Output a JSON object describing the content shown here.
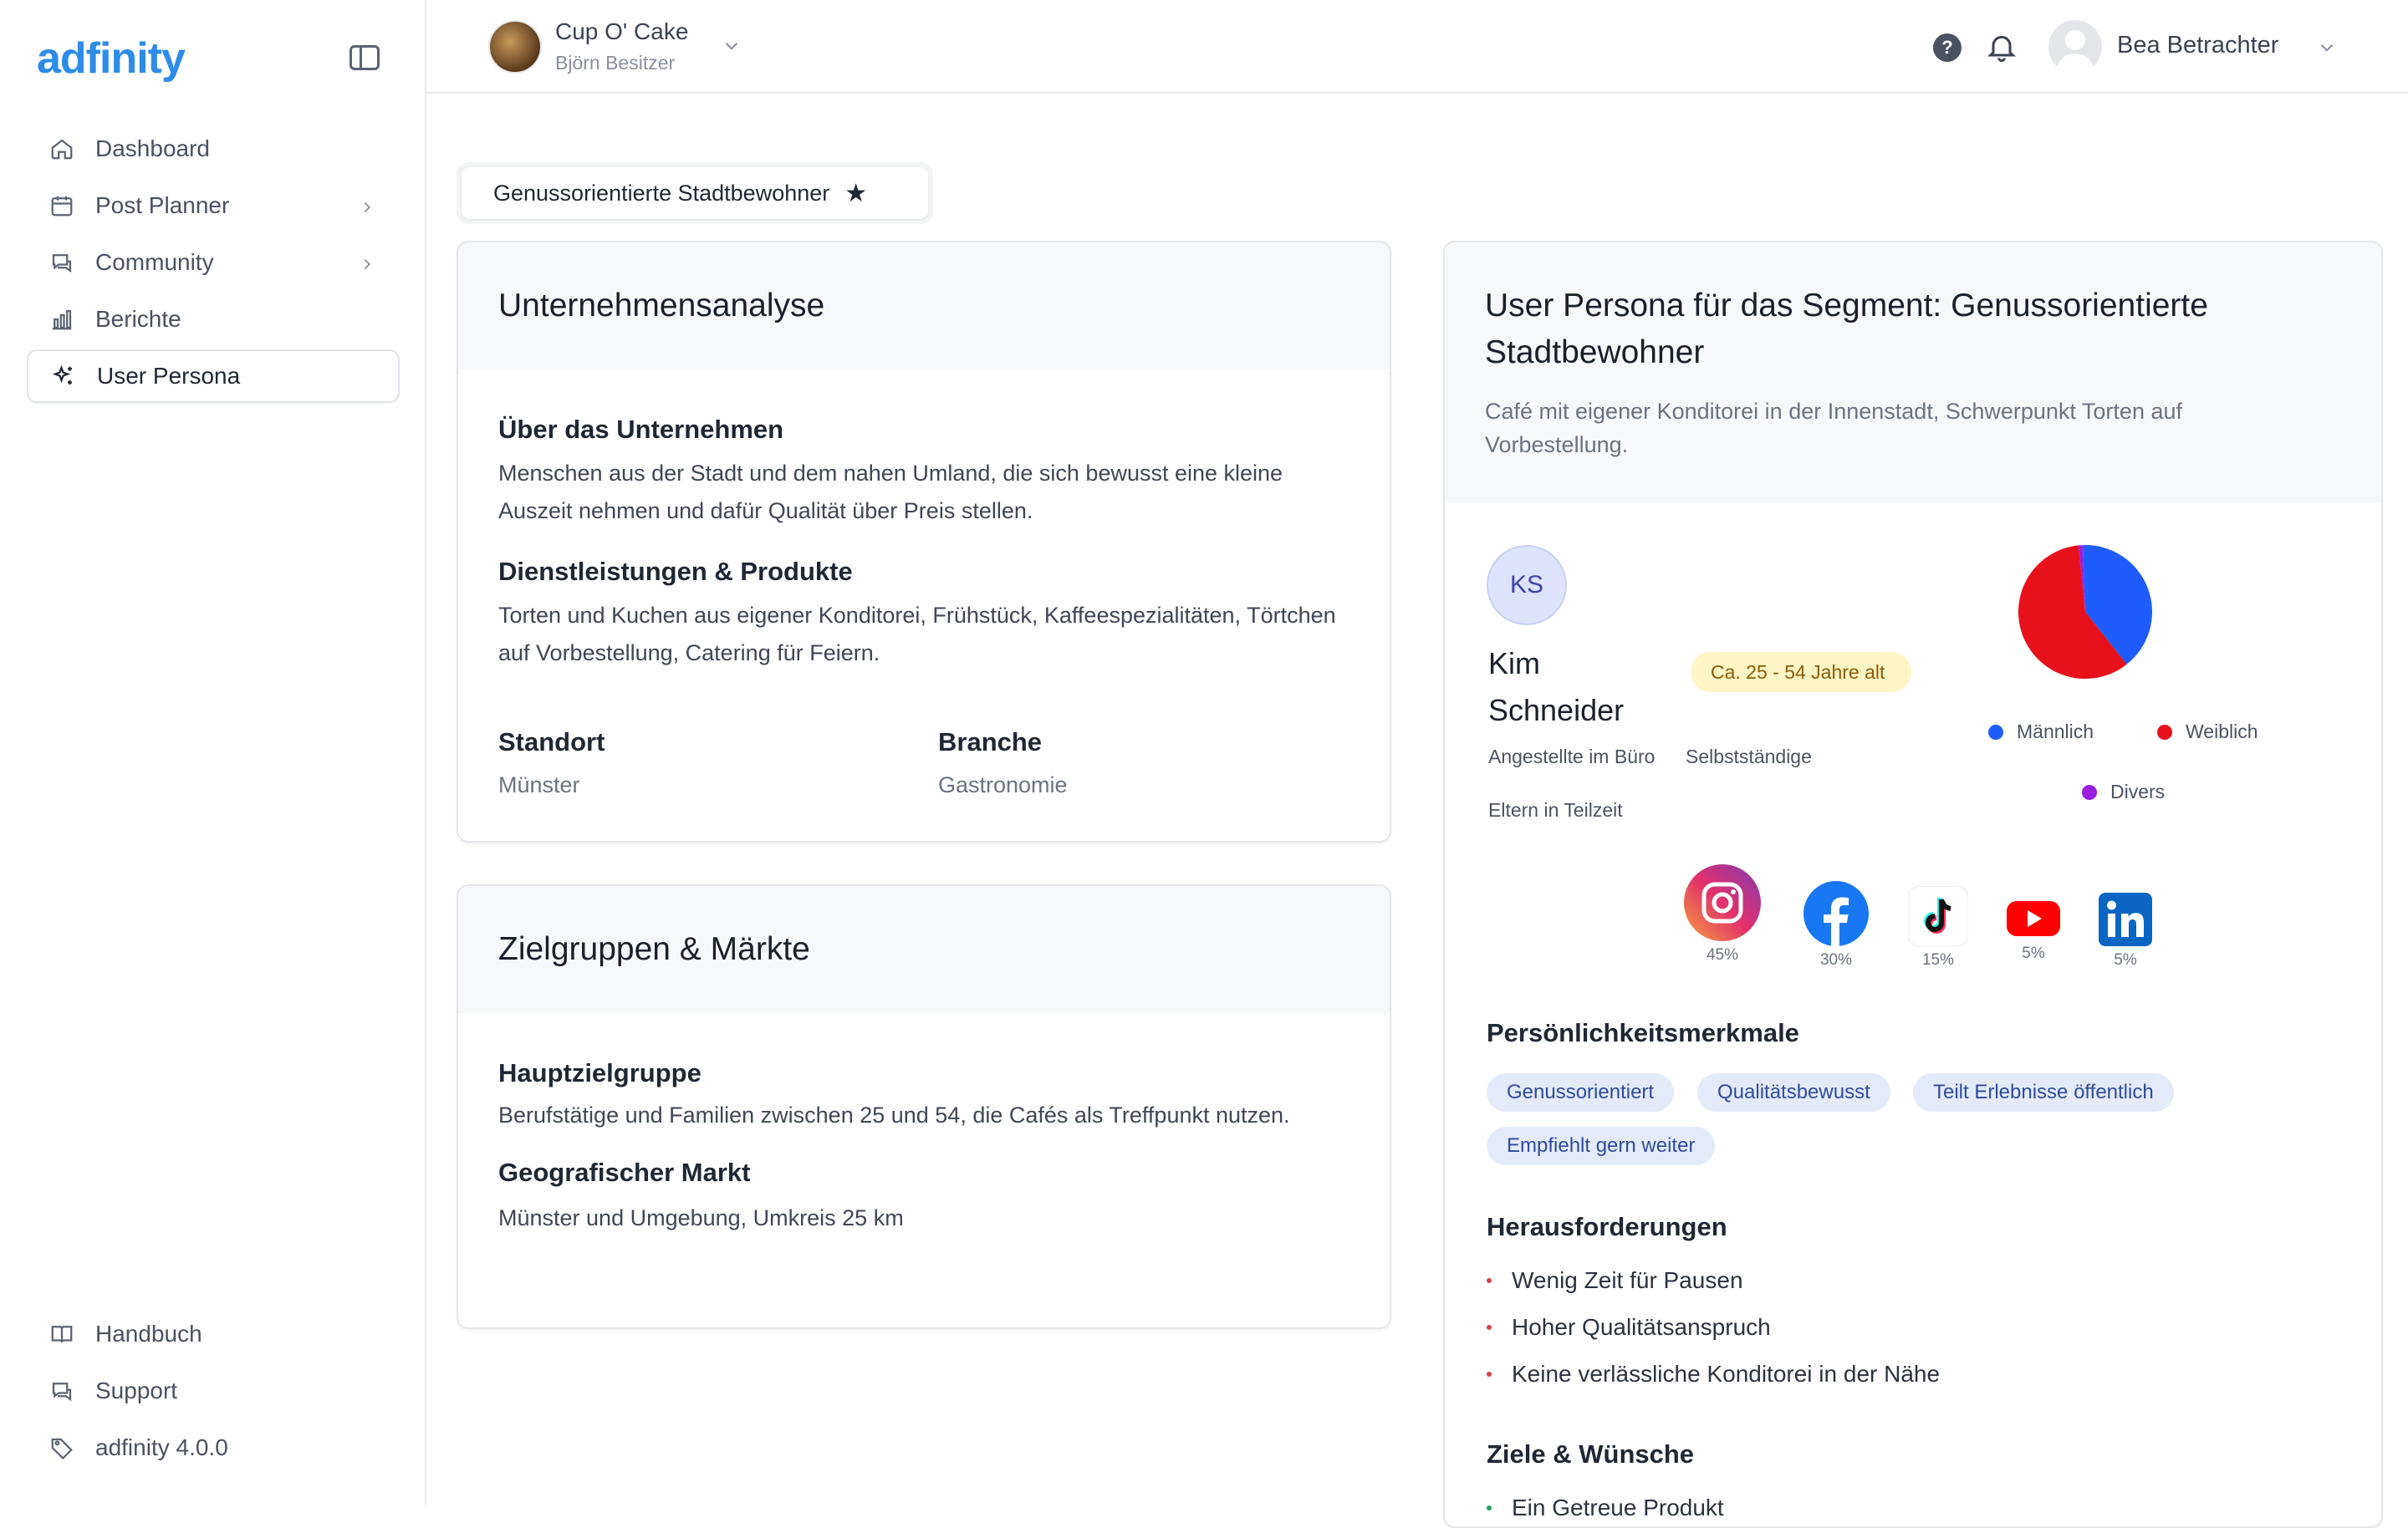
{
  "sidebar": {
    "logo": "adfinity",
    "nav": [
      {
        "label": "Dashboard"
      },
      {
        "label": "Post Planner"
      },
      {
        "label": "Community"
      },
      {
        "label": "Berichte"
      },
      {
        "label": "User Persona"
      }
    ],
    "bottom": [
      {
        "label": "Handbuch"
      },
      {
        "label": "Support"
      },
      {
        "label": "adfinity 4.0.0"
      }
    ]
  },
  "header": {
    "brand_name": "Cup O' Cake",
    "brand_owner": "Björn Besitzer",
    "user_name": "Bea Betrachter"
  },
  "segment_chip": {
    "label": "Genussorientierte Stadtbewohner"
  },
  "company_card": {
    "title": "Unternehmensanalyse",
    "about_h": "Über das Unternehmen",
    "about_t": "Menschen aus der Stadt und dem nahen Umland, die sich bewusst eine kleine Auszeit nehmen und dafür Qualität über Preis stellen.",
    "services_h": "Dienstleistungen & Produkte",
    "services_t": "Torten und Kuchen aus eigener Konditorei, Frühstück, Kaffeespezialitäten, Törtchen auf Vorbestellung, Catering für Feiern.",
    "location_h": "Standort",
    "location_v": "Münster",
    "industry_h": "Branche",
    "industry_v": "Gastronomie"
  },
  "market_card": {
    "title": "Zielgruppen & Märkte",
    "main_h": "Hauptzielgruppe",
    "main_t": "Berufstätige und Familien zwischen 25 und 54, die Cafés als Treffpunkt nutzen.",
    "geo_h": "Geografischer Markt",
    "geo_t": "Münster und Umgebung, Umkreis 25 km"
  },
  "persona_card": {
    "title": "User Persona für das Segment: Genussorientierte Stadtbewohner",
    "subtitle": "Café mit eigener Konditorei in der Innenstadt, Schwerpunkt Torten auf Vorbestellung.",
    "initials": "KS",
    "first_name": "Kim",
    "last_name": "Schneider",
    "age_badge": "Ca. 25 - 54 Jahre alt",
    "roles": [
      "Angestellte im Büro",
      "Selbstständige",
      "Eltern in Teilzeit"
    ],
    "gender_chart": {
      "slices": [
        {
          "label": "Männlich",
          "value": 40,
          "color": "#1e5cff"
        },
        {
          "label": "Weiblich",
          "value": 59,
          "color": "#e8101b"
        },
        {
          "label": "Divers",
          "value": 1,
          "color": "#9b1de0"
        }
      ]
    },
    "socials": [
      {
        "icon": "instagram-icon",
        "value": "45%"
      },
      {
        "icon": "facebook-icon",
        "value": "30%"
      },
      {
        "icon": "tiktok-icon",
        "value": "15%"
      },
      {
        "icon": "youtube-icon",
        "value": "5%"
      },
      {
        "icon": "linkedin-icon",
        "value": "5%"
      }
    ],
    "traits_h": "Persönlichkeitsmerkmale",
    "traits": [
      "Genussorientiert",
      "Qualitätsbewusst",
      "Teilt Erlebnisse öffentlich",
      "Empfiehlt gern weiter"
    ],
    "challenges_h": "Herausforderungen",
    "challenges": [
      "Wenig Zeit für Pausen",
      "Hoher Qualitätsanspruch",
      "Keine verlässliche Konditorei in der Nähe"
    ],
    "goals_h": "Ziele & Wünsche",
    "goals": [
      "Ein Getreue Produkt"
    ]
  }
}
